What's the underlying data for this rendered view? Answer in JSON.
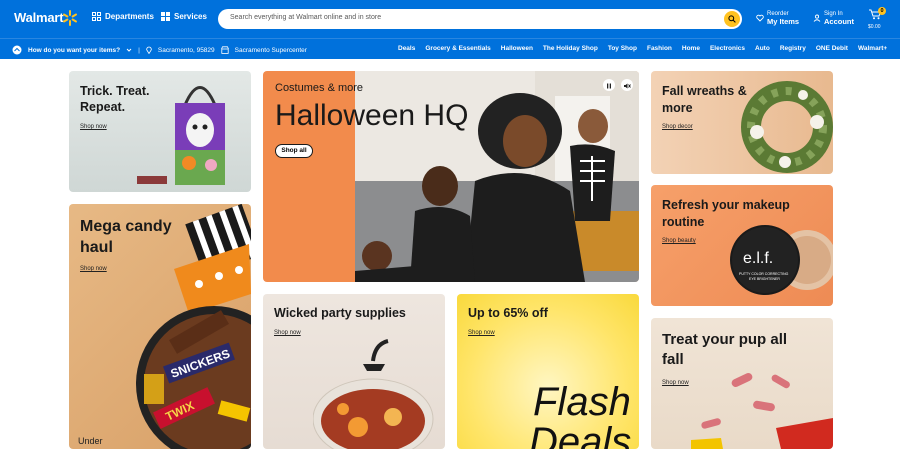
{
  "header": {
    "logo": "Walmart",
    "departments": "Departments",
    "services": "Services",
    "search_placeholder": "Search everything at Walmart online and in store",
    "reorder_top": "Reorder",
    "reorder_bottom": "My Items",
    "signin_top": "Sign In",
    "signin_bottom": "Account",
    "cart_count": "0",
    "cart_total": "$0.00"
  },
  "subbar": {
    "question": "How do you want your items?",
    "zip": "Sacramento, 95829",
    "store": "Sacramento Supercenter",
    "nav": [
      "Deals",
      "Grocery & Essentials",
      "Halloween",
      "The Holiday Shop",
      "Toy Shop",
      "Fashion",
      "Home",
      "Electronics",
      "Auto",
      "Registry",
      "ONE Debit",
      "Walmart+"
    ]
  },
  "cards": {
    "trick": {
      "title1": "Trick. Treat.",
      "title2": "Repeat.",
      "link": "Shop now"
    },
    "candy": {
      "title1": "Mega candy",
      "title2": "haul",
      "link": "Shop now",
      "bottom": "Under",
      "bag_text": "SNICKERS",
      "bag_text2": "TWIX"
    },
    "hero": {
      "sub": "Costumes & more",
      "title": "Halloween HQ",
      "btn": "Shop all"
    },
    "wreaths": {
      "title1": "Fall wreaths &",
      "title2": "more",
      "link": "Shop decor"
    },
    "makeup": {
      "title1": "Refresh your makeup",
      "title2": "routine",
      "link": "Shop beauty",
      "brand": "e.l.f.",
      "brand_sub1": "PUTTY COLOR CORRECTING",
      "brand_sub2": "EYE BRIGHTENER"
    },
    "party": {
      "title": "Wicked party supplies",
      "link": "Shop now"
    },
    "flash": {
      "title": "Up to 65% off",
      "link": "Shop now",
      "big1": "Flash",
      "big2": "Deals"
    },
    "pup": {
      "title1": "Treat your pup all",
      "title2": "fall",
      "link": "Shop now"
    }
  }
}
